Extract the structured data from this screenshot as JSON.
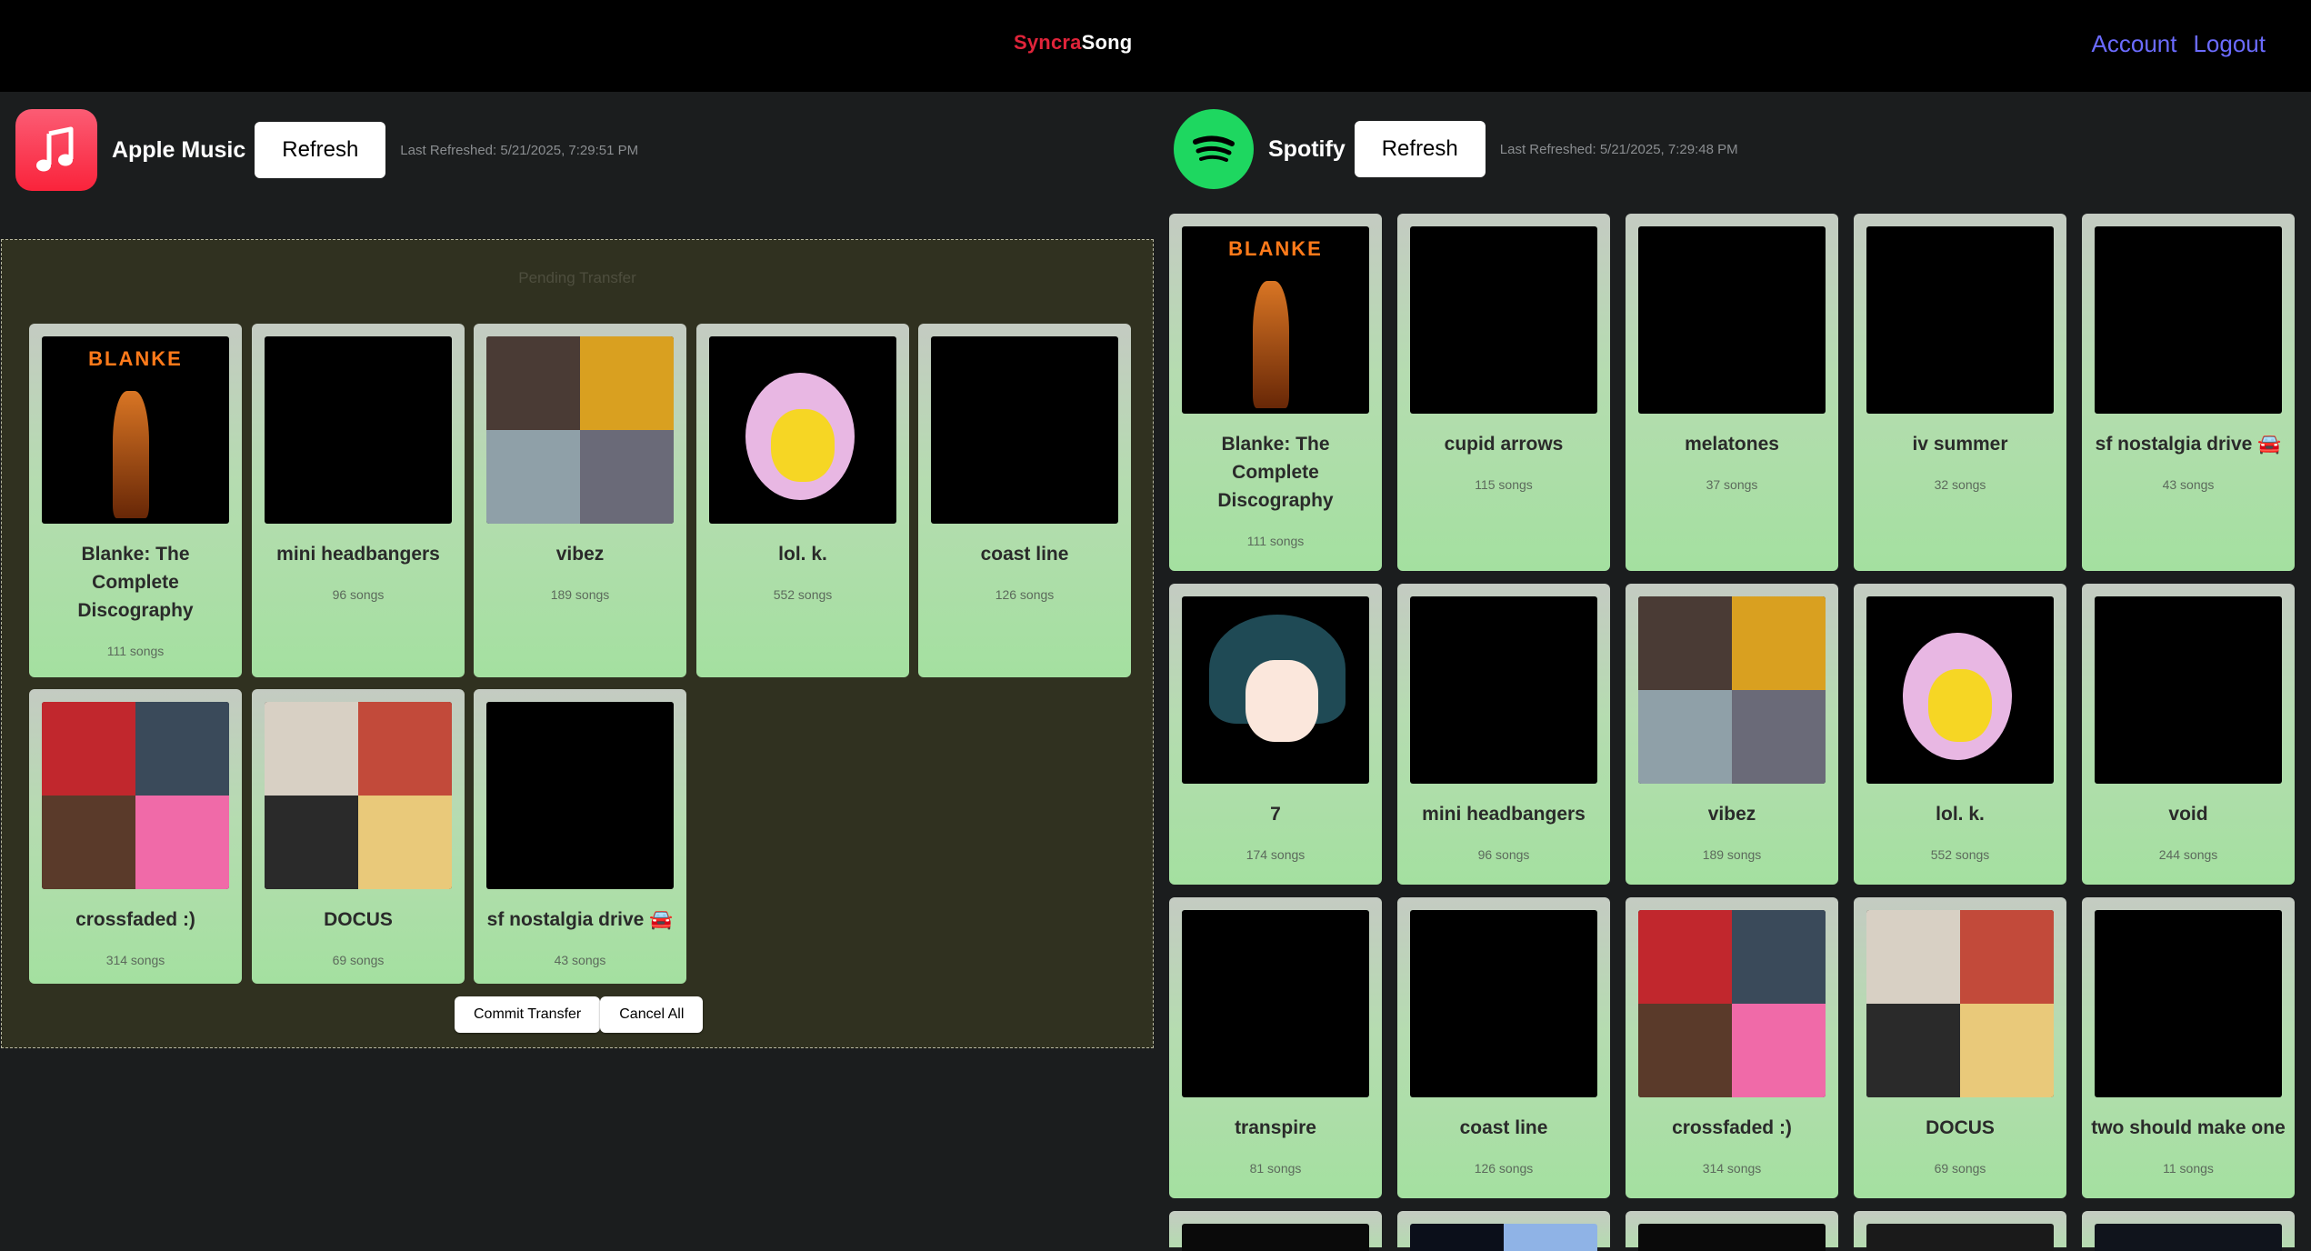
{
  "app": {
    "brand_part1": "Syncra",
    "brand_part2": "Song"
  },
  "nav": {
    "account": "Account",
    "logout": "Logout"
  },
  "colors": {
    "brand_red": "#e0243a",
    "link": "#6b6bff",
    "card_green": "#a4e0a0",
    "spotify_green": "#1ed760",
    "apple_red": "#fa233b"
  },
  "apple": {
    "name": "Apple Music",
    "refresh": "Refresh",
    "last_refreshed": "Last Refreshed: 5/21/2025, 7:29:51 PM",
    "transfer": {
      "label": "Pending Transfer",
      "commit": "Commit Transfer",
      "cancel": "Cancel All",
      "playlists": [
        {
          "title": "Blanke: The Complete Discography",
          "count": "111 songs",
          "art": "blanke"
        },
        {
          "title": "mini headbangers",
          "count": "96 songs",
          "art": "rave"
        },
        {
          "title": "vibez",
          "count": "189 songs",
          "art": "grid-vibez"
        },
        {
          "title": "lol. k.",
          "count": "552 songs",
          "art": "simpson"
        },
        {
          "title": "coast line",
          "count": "126 songs",
          "art": "laser"
        },
        {
          "title": "crossfaded :)",
          "count": "314 songs",
          "art": "grid-crossfaded"
        },
        {
          "title": "DOCUS",
          "count": "69 songs",
          "art": "grid-docus"
        },
        {
          "title": "sf nostalgia drive 🚘",
          "count": "43 songs",
          "art": "sf"
        }
      ]
    }
  },
  "spotify": {
    "name": "Spotify",
    "refresh": "Refresh",
    "last_refreshed": "Last Refreshed: 5/21/2025, 7:29:48 PM",
    "playlists": [
      {
        "title": "Blanke: The Complete Discography",
        "count": "111 songs",
        "art": "blanke"
      },
      {
        "title": "cupid arrows",
        "count": "115 songs",
        "art": "cupid"
      },
      {
        "title": "melatones",
        "count": "37 songs",
        "art": "sunset"
      },
      {
        "title": "iv summer",
        "count": "32 songs",
        "art": "ivs"
      },
      {
        "title": "sf nostalgia drive 🚘",
        "count": "43 songs",
        "art": "sf"
      },
      {
        "title": "7",
        "count": "174 songs",
        "art": "xiao"
      },
      {
        "title": "mini headbangers",
        "count": "96 songs",
        "art": "rave"
      },
      {
        "title": "vibez",
        "count": "189 songs",
        "art": "grid-vibez"
      },
      {
        "title": "lol. k.",
        "count": "552 songs",
        "art": "simpson"
      },
      {
        "title": "void",
        "count": "244 songs",
        "art": "void"
      },
      {
        "title": "transpire",
        "count": "81 songs",
        "art": "black"
      },
      {
        "title": "coast line",
        "count": "126 songs",
        "art": "laser"
      },
      {
        "title": "crossfaded :)",
        "count": "314 songs",
        "art": "grid-crossfaded"
      },
      {
        "title": "DOCUS",
        "count": "69 songs",
        "art": "grid-docus"
      },
      {
        "title": "two should make one",
        "count": "11 songs",
        "art": "black"
      }
    ]
  }
}
